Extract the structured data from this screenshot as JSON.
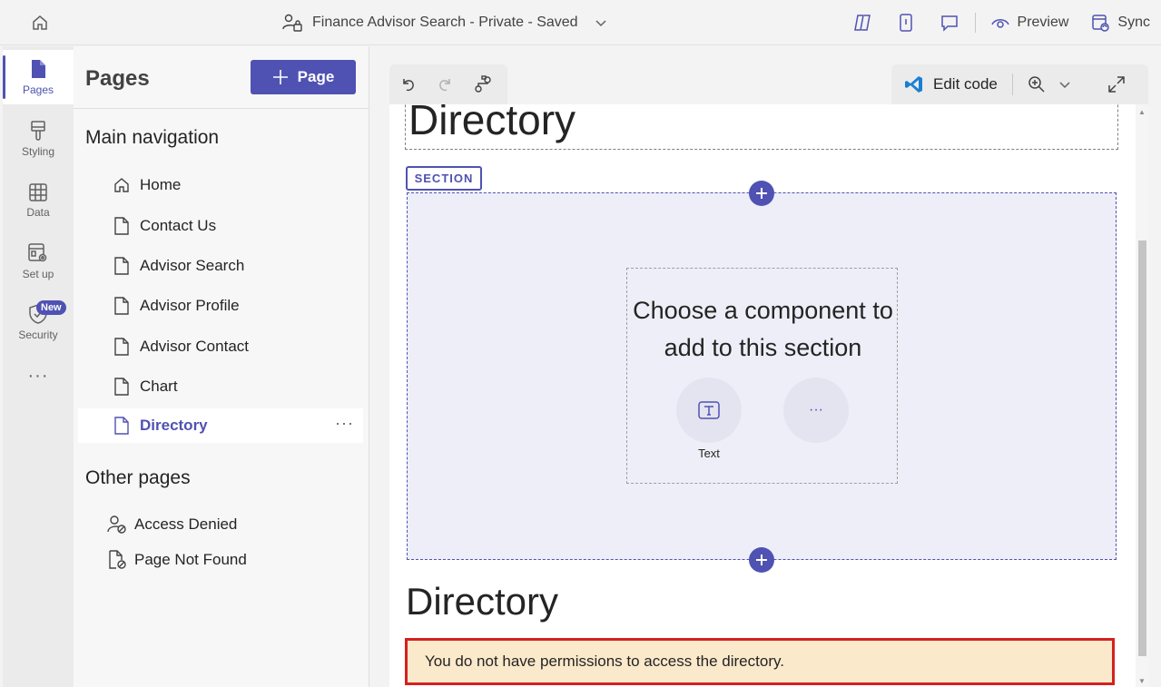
{
  "topbar": {
    "title": "Finance Advisor Search - Private - Saved",
    "preview_label": "Preview",
    "sync_label": "Sync",
    "icons": [
      "home-icon",
      "site-lock-icon",
      "chevron-down-icon",
      "copilot-icon",
      "mobile-icon",
      "comment-icon",
      "eye-icon",
      "sync-icon"
    ]
  },
  "rail": {
    "items": [
      {
        "label": "Pages",
        "icon": "page-icon",
        "active": true
      },
      {
        "label": "Styling",
        "icon": "brush-icon"
      },
      {
        "label": "Data",
        "icon": "table-icon"
      },
      {
        "label": "Set up",
        "icon": "settings-icon"
      },
      {
        "label": "Security",
        "icon": "shield-icon",
        "badge": "New"
      }
    ],
    "more": "···"
  },
  "pages_panel": {
    "title": "Pages",
    "add_button": "Page",
    "main_nav_heading": "Main navigation",
    "main_nav": [
      {
        "label": "Home",
        "icon": "home-icon"
      },
      {
        "label": "Contact Us",
        "icon": "document-icon"
      },
      {
        "label": "Advisor Search",
        "icon": "document-icon"
      },
      {
        "label": "Advisor Profile",
        "icon": "document-icon"
      },
      {
        "label": "Advisor Contact",
        "icon": "document-icon"
      },
      {
        "label": "Chart",
        "icon": "document-icon"
      },
      {
        "label": "Directory",
        "icon": "document-icon",
        "active": true
      }
    ],
    "more_label": "···",
    "other_heading": "Other pages",
    "other_pages": [
      {
        "label": "Access Denied",
        "icon": "person-blocked-icon"
      },
      {
        "label": "Page Not Found",
        "icon": "document-blocked-icon"
      }
    ]
  },
  "canvas": {
    "edit_code_label": "Edit code",
    "heading_top": "Directory",
    "section_tag": "SECTION",
    "chooser_text": "Choose a component to add to this section",
    "component_text_label": "Text",
    "component_more": "···",
    "heading_bottom": "Directory",
    "alert_text": "You do not have permissions to access the directory."
  },
  "colors": {
    "accent": "#4f52b2",
    "alert_bg": "#fbe9cb",
    "alert_border": "#d52020",
    "section_bg": "#eeeef8"
  }
}
